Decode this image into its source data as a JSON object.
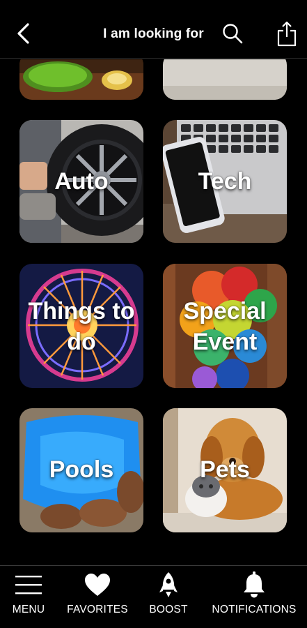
{
  "header": {
    "title": "I am looking for",
    "back_icon": "back-arrow-icon",
    "search_icon": "search-icon",
    "share_icon": "share-icon"
  },
  "categories": [
    {
      "label": "Auto"
    },
    {
      "label": "Tech"
    },
    {
      "label": "Things to do"
    },
    {
      "label": "Special Event"
    },
    {
      "label": "Pools"
    },
    {
      "label": "Pets"
    }
  ],
  "tabbar": {
    "menu": "MENU",
    "favorites": "FAVORITES",
    "boost": "BOOST",
    "notifications": "NOTIFICATIONS"
  },
  "colors": {
    "background": "#000000",
    "text": "#ffffff"
  }
}
